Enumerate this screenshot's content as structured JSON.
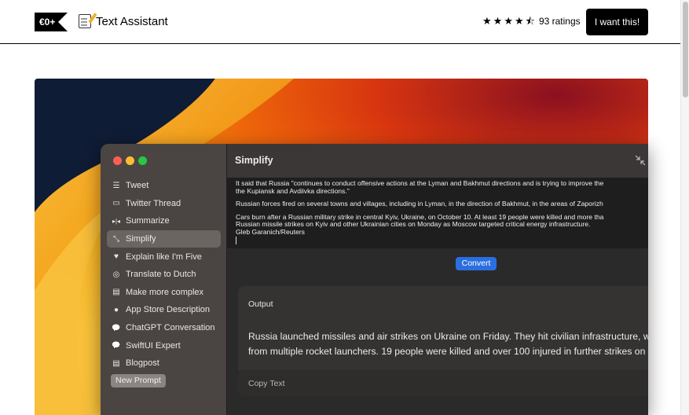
{
  "header": {
    "price": "€0+",
    "product_name": "Text Assistant",
    "rating_stars": 4.5,
    "ratings_text": "93 ratings",
    "buy_label": "I want this!"
  },
  "app": {
    "window_title": "Simplify",
    "sidebar": [
      {
        "label": "Tweet",
        "icon": "list-icon",
        "glyph": "☰"
      },
      {
        "label": "Twitter Thread",
        "icon": "laptop-icon",
        "glyph": "▭"
      },
      {
        "label": "Summarize",
        "icon": "summarize-icon",
        "glyph": "▸|◂"
      },
      {
        "label": "Simplify",
        "icon": "shrink-arrows-icon",
        "glyph": "⤡"
      },
      {
        "label": "Explain like I'm Five",
        "icon": "heart-icon",
        "glyph": "♥"
      },
      {
        "label": "Translate to Dutch",
        "icon": "globe-icon",
        "glyph": "◎"
      },
      {
        "label": "Make more complex",
        "icon": "document-icon",
        "glyph": "▤"
      },
      {
        "label": "App Store Description",
        "icon": "circle-icon",
        "glyph": "●"
      },
      {
        "label": "ChatGPT Conversation",
        "icon": "chat-bubble-icon",
        "glyph": "💬"
      },
      {
        "label": "SwiftUI Expert",
        "icon": "chat-bubble-icon",
        "glyph": "💬"
      },
      {
        "label": "Blogpost",
        "icon": "document-icon",
        "glyph": "▤"
      }
    ],
    "selected_index": 3,
    "new_prompt_label": "New Prompt",
    "editor_lines": [
      "It said that Russia \"continues to conduct offensive actions at the Lyman and Bakhmut directions and is trying to improve the",
      "the Kupiansk and Avdiivka directions.\"",
      "Russian forces fired on several towns and villages, including in Lyman, in the direction of Bakhmut, in the areas of Zaporizh",
      "Cars burn after a Russian military strike in central Kyiv, Ukraine, on October 10. At least 19 people were killed and more tha",
      "Russian missile strikes on Kyiv and other Ukrainian cities on Monday as Moscow targeted critical energy infrastructure.",
      "Gleb Garanich/Reuters"
    ],
    "convert_label": "Convert",
    "output_label": "Output",
    "output_lines": [
      "Russia launched missiles and air strikes on Ukraine on Friday. They hit civilian infrastructure, wit",
      "from multiple rocket launchers. 19 people were killed and over 100 injured in further strikes on M"
    ],
    "copy_label": "Copy Text"
  },
  "colors": {
    "accent_blue": "#2a6fe0",
    "traffic_red": "#fe5f57",
    "traffic_yellow": "#febc2e",
    "traffic_green": "#28c840"
  }
}
